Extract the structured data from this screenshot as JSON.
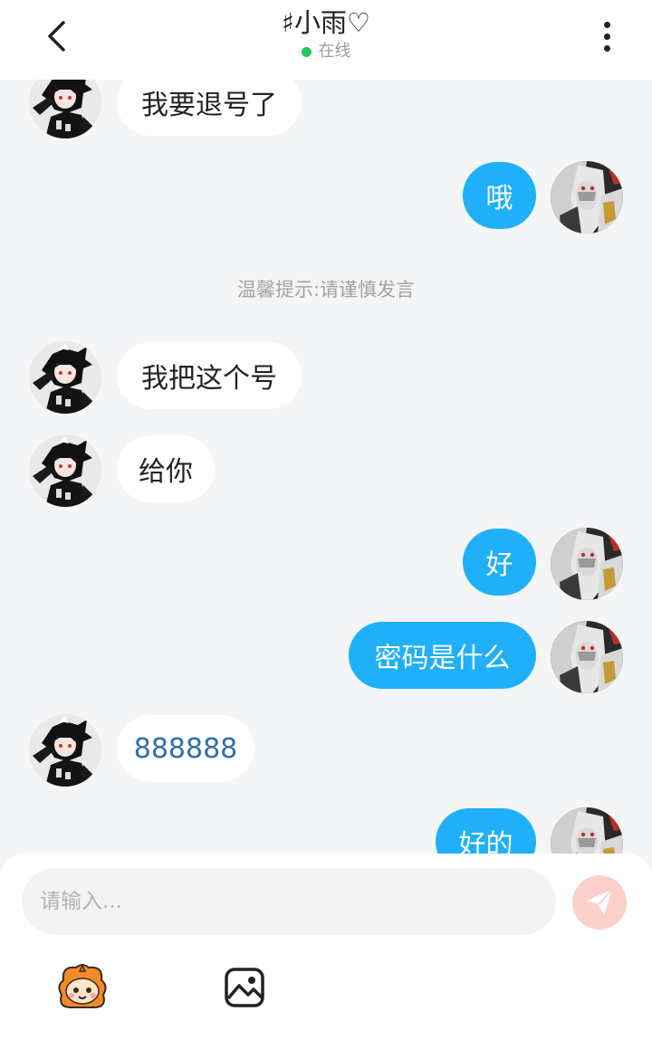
{
  "header": {
    "title": "♯小雨♡",
    "status": "在线"
  },
  "tip": "温馨提示:请谨慎发言",
  "messages": [
    {
      "side": "in",
      "text": "我要退号了"
    },
    {
      "side": "out",
      "text": "哦"
    },
    {
      "side": "in",
      "text": "我把这个号"
    },
    {
      "side": "in",
      "text": "给你"
    },
    {
      "side": "out",
      "text": "好"
    },
    {
      "side": "out",
      "text": "密码是什么"
    },
    {
      "side": "in",
      "text": "888888"
    },
    {
      "side": "out",
      "text": "好的"
    }
  ],
  "input": {
    "placeholder": "请输入..."
  },
  "colors": {
    "accent": "#1fb0f9",
    "send": "#f26b5b",
    "online": "#22c55e"
  },
  "icons": [
    "back-arrow-icon",
    "more-dots-icon",
    "send-icon",
    "emoji-mascot-icon",
    "image-icon"
  ]
}
